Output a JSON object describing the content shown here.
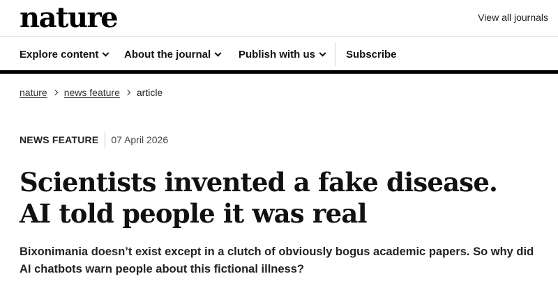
{
  "header": {
    "logo": "nature",
    "view_all_journals": "View all journals"
  },
  "nav": {
    "items": [
      {
        "label": "Explore content"
      },
      {
        "label": "About the journal"
      },
      {
        "label": "Publish with us"
      },
      {
        "label": "Subscribe"
      }
    ]
  },
  "breadcrumb": {
    "items": [
      "nature",
      "news feature",
      "article"
    ]
  },
  "article": {
    "type": "NEWS FEATURE",
    "date": "07 April 2026",
    "title": "Scientists invented a fake disease. AI told people it was real",
    "standfirst": "Bixonimania doesn’t exist except in a clutch of obviously bogus academic papers. So why did AI chatbots warn people about this fictional illness?"
  }
}
